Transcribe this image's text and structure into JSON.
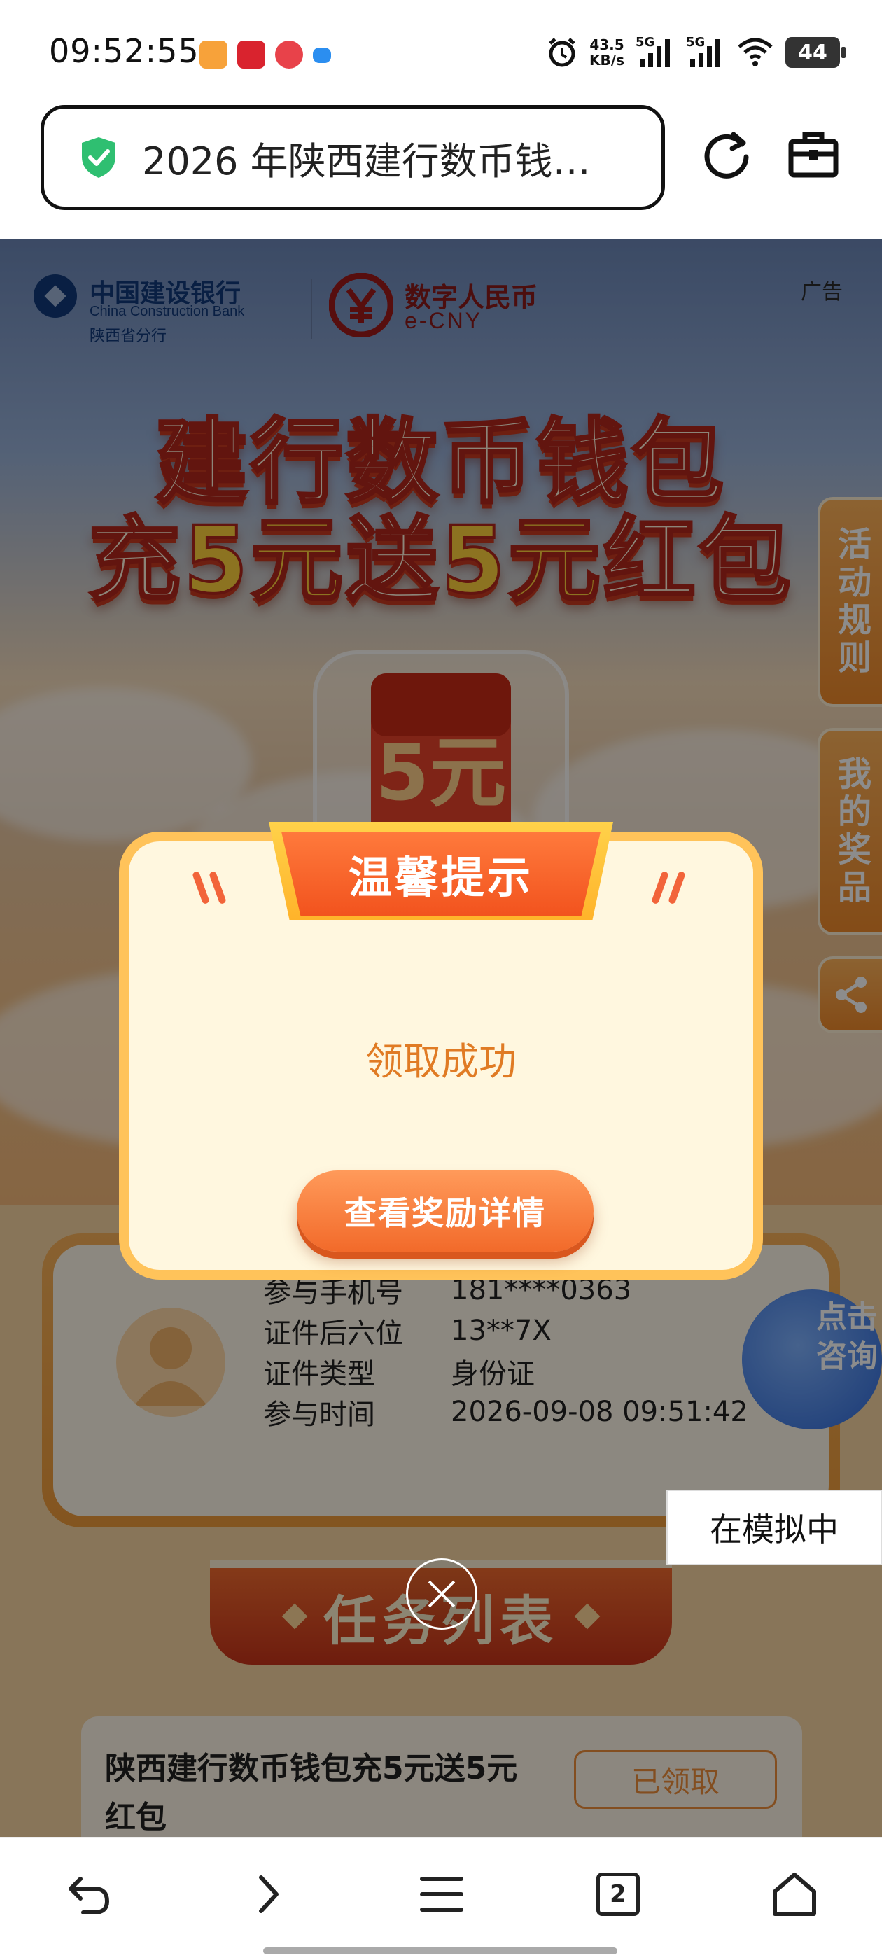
{
  "status_bar": {
    "time": "09:52:55",
    "net_speed_value": "43.5",
    "net_speed_unit": "KB/s",
    "signal_1_label": "5G",
    "signal_2_label": "5G",
    "battery": "44"
  },
  "url_bar": {
    "title": "2026 年陕西建行数币钱…"
  },
  "page": {
    "ccb_name_cn": "中国建设银行",
    "ccb_name_en": "China Construction Bank",
    "ccb_branch": "陕西省分行",
    "ecny_name_cn": "数字人民币",
    "ecny_name_en": "e-CNY",
    "ad_label": "广告",
    "hero_line1": "建行数币钱包",
    "hero_line2_a": "充",
    "hero_line2_b": "5元",
    "hero_line2_c": "送",
    "hero_line2_d": "5元",
    "hero_line2_e": "红包",
    "prize_amount": "5元",
    "side_rules": "活动规则",
    "side_prizes": "我的奖品",
    "info": [
      {
        "key": "参与手机号",
        "value": "181****0363"
      },
      {
        "key": "证件后六位",
        "value": "13**7X"
      },
      {
        "key": "证件类型",
        "value": "身份证"
      },
      {
        "key": "参与时间",
        "value": "2026-09-08 09:51:42"
      }
    ],
    "consult_text": "点击咨询",
    "task_list_title": "任务列表",
    "task_name": "陕西建行数币钱包充5元送5元红包",
    "task_button": "已领取"
  },
  "modal": {
    "title": "温馨提示",
    "message": "领取成功",
    "button": "查看奖励详情"
  },
  "toast": "在模拟中",
  "bottom_nav": {
    "tab_count": "2"
  },
  "colors": {
    "accent_orange": "#f26a2a",
    "modal_border": "#ffc35a",
    "message_text": "#e07b24",
    "secure_green": "#2fbf71"
  }
}
